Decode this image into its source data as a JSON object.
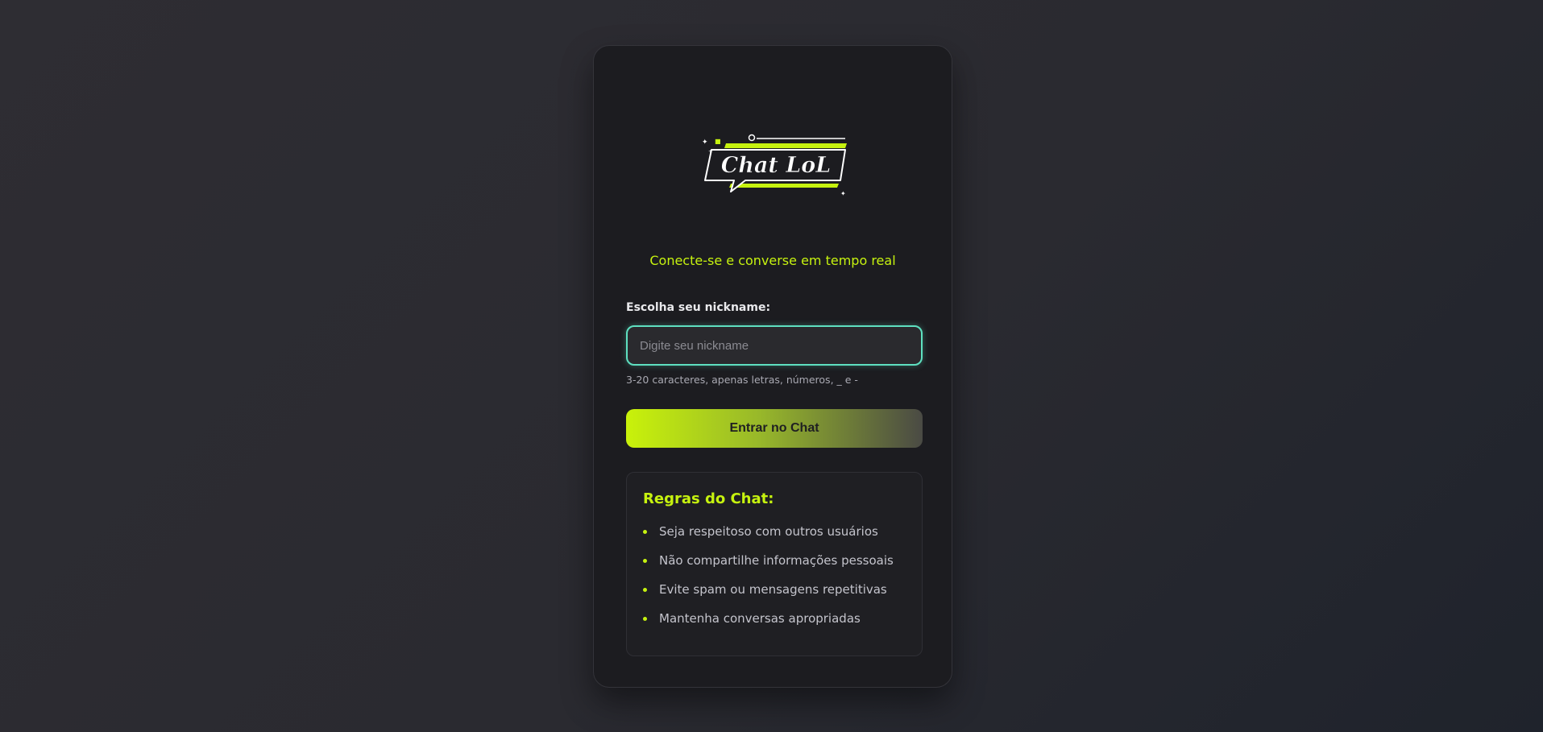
{
  "logo": {
    "text": "Chat LoL",
    "accent_color": "#c6f20f"
  },
  "tagline": "Conecte-se e converse em tempo real",
  "form": {
    "label": "Escolha seu nickname:",
    "input_value": "",
    "input_placeholder": "Digite seu nickname",
    "hint": "3-20 caracteres, apenas letras, números, _ e -",
    "submit_label": "Entrar no Chat"
  },
  "rules": {
    "title": "Regras do Chat:",
    "items": [
      "Seja respeitoso com outros usuários",
      "Não compartilhe informações pessoais",
      "Evite spam ou mensagens repetitivas",
      "Mantenha conversas apropriadas"
    ]
  },
  "colors": {
    "accent": "#c6f20f",
    "input_focus": "#5ee0c0",
    "card_bg": "#1c1c20"
  }
}
